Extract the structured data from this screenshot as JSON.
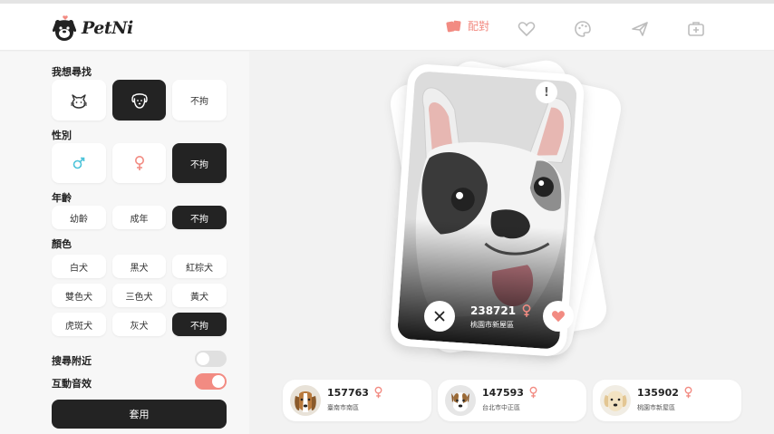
{
  "app": {
    "logo_text": "PetNi"
  },
  "nav": {
    "items": [
      {
        "label": "配對",
        "icon": "cards-icon",
        "active": true
      },
      {
        "icon": "heart-outline-icon"
      },
      {
        "icon": "palette-icon"
      },
      {
        "icon": "paper-plane-icon"
      },
      {
        "icon": "first-aid-icon"
      }
    ]
  },
  "filters": {
    "search_title": "我想尋找",
    "search_options": [
      {
        "icon": "cat-icon",
        "selected": false
      },
      {
        "icon": "dog-icon",
        "selected": true
      },
      {
        "label": "不拘",
        "selected": false
      }
    ],
    "gender_title": "性別",
    "gender_options": [
      {
        "icon": "male-icon",
        "selected": false
      },
      {
        "icon": "female-icon",
        "selected": false
      },
      {
        "label": "不拘",
        "selected": true
      }
    ],
    "age_title": "年齡",
    "age_options": [
      {
        "label": "幼齡",
        "selected": false
      },
      {
        "label": "成年",
        "selected": false
      },
      {
        "label": "不拘",
        "selected": true
      }
    ],
    "color_title": "顏色",
    "color_options": [
      {
        "label": "白犬",
        "selected": false
      },
      {
        "label": "黑犬",
        "selected": false
      },
      {
        "label": "紅棕犬",
        "selected": false
      },
      {
        "label": "雙色犬",
        "selected": false
      },
      {
        "label": "三色犬",
        "selected": false
      },
      {
        "label": "黃犬",
        "selected": false
      },
      {
        "label": "虎斑犬",
        "selected": false
      },
      {
        "label": "灰犬",
        "selected": false
      },
      {
        "label": "不拘",
        "selected": true
      }
    ],
    "nearby_label": "搜尋附近",
    "nearby_on": false,
    "sound_label": "互動音效",
    "sound_on": true,
    "apply_label": "套用"
  },
  "card": {
    "id": "238721",
    "gender": "female",
    "location": "桃園市新屋區"
  },
  "matches": [
    {
      "id": "157763",
      "location": "臺南市南區",
      "gender": "female"
    },
    {
      "id": "147593",
      "location": "台北市中正區",
      "gender": "female"
    },
    {
      "id": "135902",
      "location": "桃園市新屋區",
      "gender": "female"
    }
  ],
  "colors": {
    "accent": "#f28b82",
    "dark": "#232323",
    "male": "#4cc3d9"
  }
}
